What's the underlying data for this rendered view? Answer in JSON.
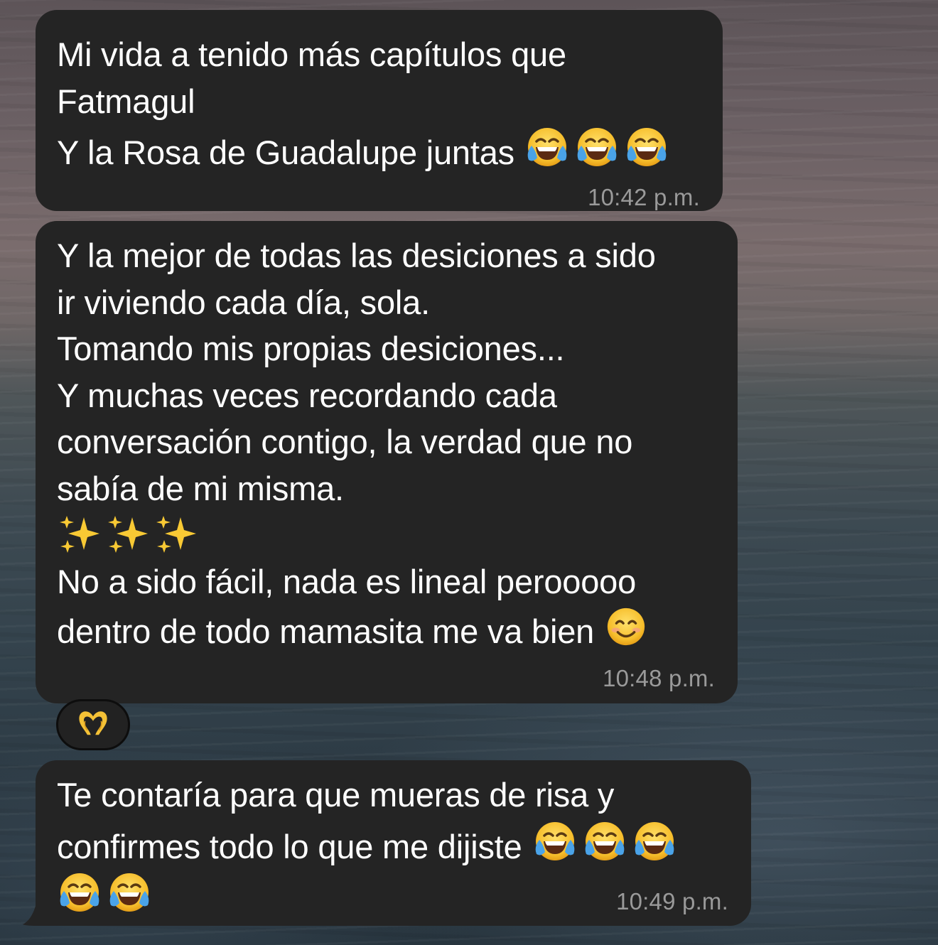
{
  "chat": {
    "messages": [
      {
        "lines": [
          "Mi vida a tenido más capítulos que",
          "Fatmagul",
          "Y la Rosa de Guadalupe juntas"
        ],
        "trailing_emojis": [
          "face-with-tears-of-joy",
          "face-with-tears-of-joy",
          "face-with-tears-of-joy"
        ],
        "time": "10:42 p.m."
      },
      {
        "lines": [
          "Y la mejor de todas las desiciones a sido",
          "ir viviendo cada día, sola.",
          "Tomando mis propias desiciones...",
          "Y muchas veces recordando cada",
          "conversación contigo, la verdad que no",
          "sabía de mi misma.",
          "",
          "No a sido fácil, nada es lineal perooooo",
          "dentro de todo mamasita me va bien"
        ],
        "sparkles_line_emojis": [
          "sparkles",
          "sparkles",
          "sparkles"
        ],
        "trailing_emojis": [
          "smiling-face-with-smiling-eyes"
        ],
        "time": "10:48 p.m.",
        "reaction": "heart-hands"
      },
      {
        "lines": [
          "Te contaría para que mueras de risa y",
          "confirmes todo lo que me dijiste"
        ],
        "trailing_emojis": [
          "face-with-tears-of-joy",
          "face-with-tears-of-joy",
          "face-with-tears-of-joy",
          "face-with-tears-of-joy",
          "face-with-tears-of-joy"
        ],
        "time": "10:49 p.m."
      }
    ]
  },
  "colors": {
    "bubble": "#242424",
    "text": "#ffffff",
    "timestamp": "#9a9a9a",
    "emoji_yellow": "#f7c332"
  }
}
